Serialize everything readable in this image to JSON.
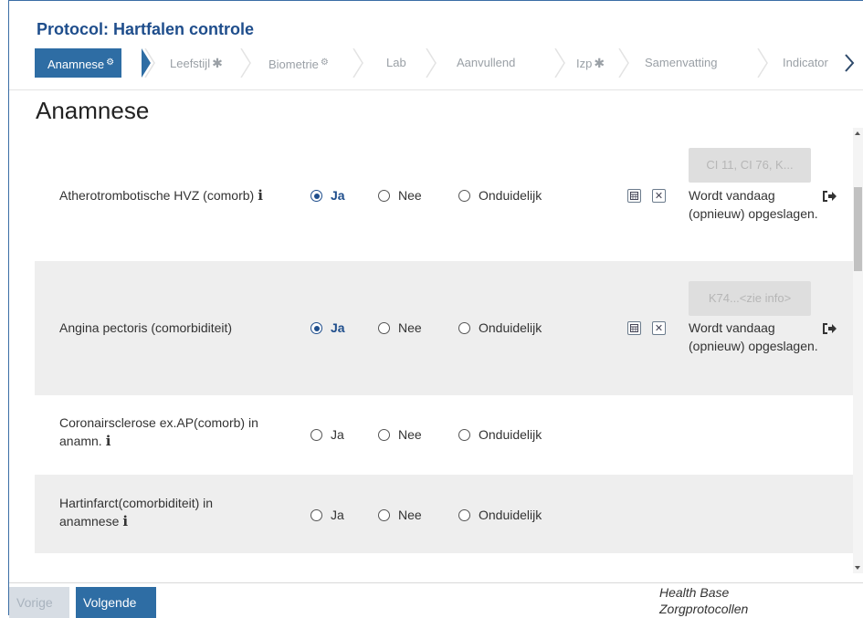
{
  "header": {
    "title": "Protocol: Hartfalen controle"
  },
  "steps": [
    {
      "label": "Anamnese",
      "marker": "gear",
      "active": true
    },
    {
      "label": "Leefstijl",
      "marker": "asterisk",
      "active": false
    },
    {
      "label": "Biometrie",
      "marker": "gear",
      "active": false
    },
    {
      "label": "Lab",
      "marker": "",
      "active": false
    },
    {
      "label": "Aanvullend",
      "marker": "",
      "active": false
    },
    {
      "label": "Izp",
      "marker": "asterisk",
      "active": false
    },
    {
      "label": "Samenvatting",
      "marker": "",
      "active": false
    },
    {
      "label": "Indicator",
      "marker": "",
      "active": false
    }
  ],
  "section": {
    "title": "Anamnese"
  },
  "options": {
    "yes": "Ja",
    "no": "Nee",
    "unclear": "Onduidelijk"
  },
  "rows": [
    {
      "label": "Atherotrombotische HVZ (comorb)",
      "info": "i",
      "selected": "yes",
      "code": "CI 11, CI 76, K...",
      "status": "Wordt vandaag (opnieuw) opgeslagen."
    },
    {
      "label": "Angina pectoris (comorbiditeit)",
      "info": "",
      "selected": "yes",
      "code": "K74...<zie info>",
      "status": "Wordt vandaag (opnieuw) opgeslagen."
    },
    {
      "label_line1": "Coronairsclerose ex.AP(comorb) in",
      "label_line2": "anamn.",
      "info": "i",
      "selected": ""
    },
    {
      "label_line1": "Hartinfarct(comorbiditeit) in",
      "label_line2": "anamnese",
      "info": "i",
      "selected": ""
    }
  ],
  "footer": {
    "prev_label": "Vorige",
    "next_label": "Volgende",
    "brand_line1": "Health Base",
    "brand_line2": "Zorgprotocollen"
  },
  "colors": {
    "primary": "#2e6da4",
    "title": "#1f4e8c",
    "row_alt": "#eeeeee"
  }
}
